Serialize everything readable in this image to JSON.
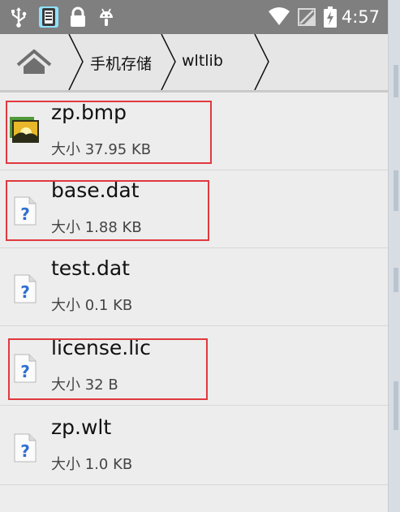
{
  "status_bar": {
    "time": "4:57",
    "icons": [
      "usb-icon",
      "sim-card-icon",
      "lock-icon",
      "android-debug-icon",
      "wifi-icon",
      "no-sim-icon",
      "battery-charging-icon"
    ]
  },
  "breadcrumb": {
    "home_icon": "home-icon",
    "items": [
      {
        "label": "手机存储"
      },
      {
        "label": "wltlib"
      }
    ]
  },
  "files": [
    {
      "name": "zp.bmp",
      "size": "大小 37.95 KB",
      "icon": "image-file-icon",
      "highlighted": true
    },
    {
      "name": "base.dat",
      "size": "大小 1.88 KB",
      "icon": "unknown-file-icon",
      "highlighted": true
    },
    {
      "name": "test.dat",
      "size": "大小 0.1 KB",
      "icon": "unknown-file-icon",
      "highlighted": false
    },
    {
      "name": "license.lic",
      "size": "大小 32 B",
      "icon": "unknown-file-icon",
      "highlighted": true
    },
    {
      "name": "zp.wlt",
      "size": "大小 1.0 KB",
      "icon": "unknown-file-icon",
      "highlighted": false
    }
  ],
  "colors": {
    "highlight_border": "#e0393e",
    "status_bar_bg": "#7f7f7f",
    "list_bg": "#ededed",
    "help_icon_blue": "#2f6fd0"
  }
}
